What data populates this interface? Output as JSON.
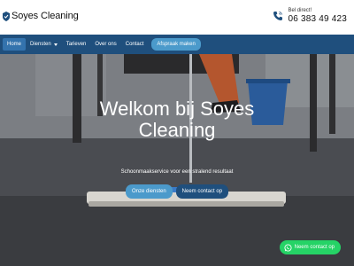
{
  "header": {
    "logo_text": "Soyes Cleaning",
    "phone_label": "Bel direct!",
    "phone_number": "06 383 49 423"
  },
  "nav": {
    "items": [
      {
        "label": "Home"
      },
      {
        "label": "Diensten"
      },
      {
        "label": "Tarieven"
      },
      {
        "label": "Over ons"
      },
      {
        "label": "Contact"
      }
    ],
    "cta_label": "Afspraak maken"
  },
  "hero": {
    "title_line1": "Welkom bij Soyes",
    "title_line2": "Cleaning",
    "subtitle": "Schoonmaakservice voor een stralend resultaat",
    "primary_button": "Onze diensten",
    "secondary_button": "Neem contact op"
  },
  "whatsapp": {
    "label": "Neem contact op"
  },
  "colors": {
    "nav_bg": "#1f4f7d",
    "nav_active": "#3473ad",
    "accent_light": "#4b9acb",
    "whatsapp": "#25d366"
  }
}
